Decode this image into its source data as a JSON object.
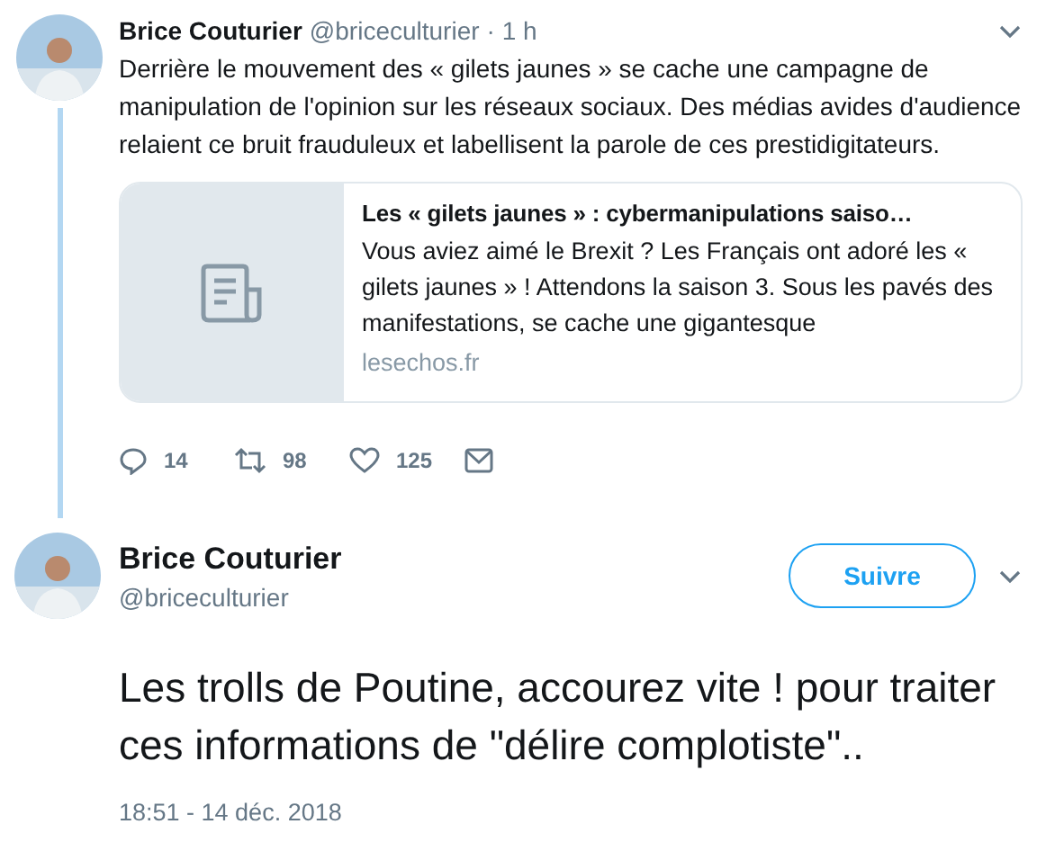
{
  "thread_tweet": {
    "author": {
      "name": "Brice Couturier",
      "handle": "@briceculturier"
    },
    "time": "· 1 h",
    "text": "Derrière le mouvement des « gilets jaunes » se cache une campagne de manipulation de l'opinion sur les réseaux sociaux. Des médias avides d'audience relaient ce bruit frauduleux et labellisent la parole de ces prestidigitateurs.",
    "link_card": {
      "title": "Les « gilets jaunes » : cybermanipulations saiso…",
      "description": "Vous aviez aimé le Brexit ? Les Français ont adoré les « gilets jaunes » ! Attendons la saison 3. Sous les pavés des manifestations, se cache une gigantesque",
      "domain": "lesechos.fr"
    },
    "actions": [
      {
        "kind": "reply",
        "count": "14"
      },
      {
        "kind": "retweet",
        "count": "98"
      },
      {
        "kind": "like",
        "count": "125"
      },
      {
        "kind": "message"
      }
    ]
  },
  "main_tweet": {
    "author": {
      "name": "Brice Couturier",
      "handle": "@briceculturier"
    },
    "follow_button": "Suivre",
    "text": "Les trolls de Poutine, accourez vite ! pour traiter ces informations de \"délire complotiste\"..",
    "timestamp": "18:51 - 14 déc. 2018"
  }
}
